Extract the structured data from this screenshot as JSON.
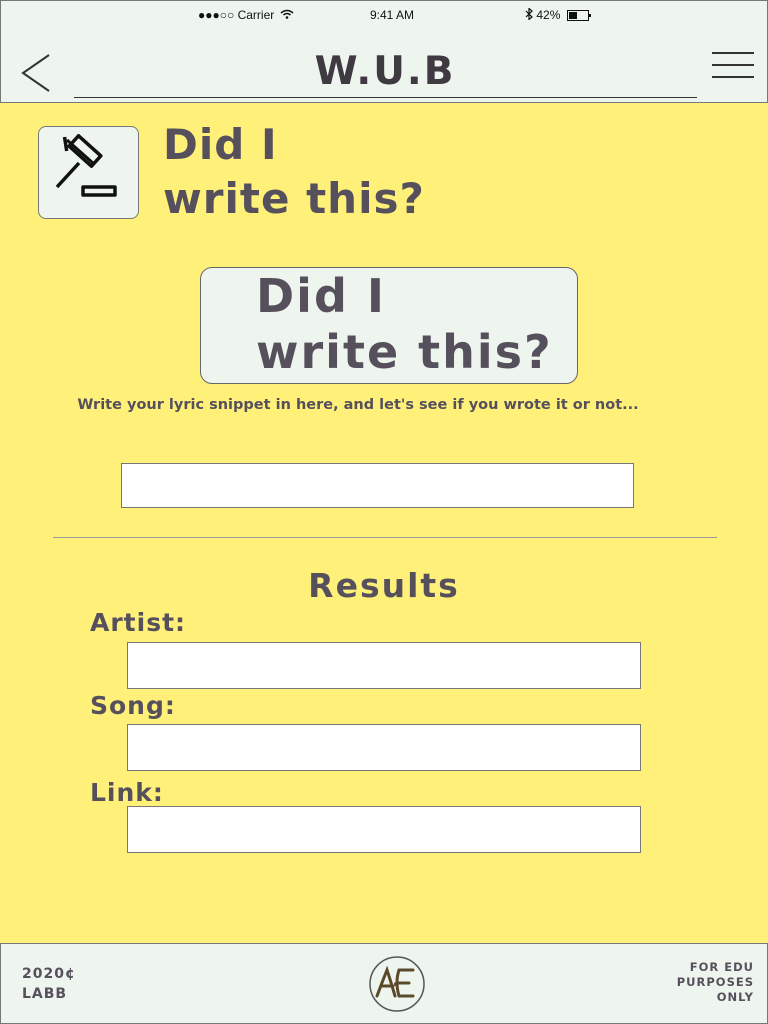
{
  "status_bar": {
    "carrier": "●●●○○ Carrier",
    "wifi_icon": "wifi-icon",
    "time": "9:41 AM",
    "bluetooth_icon": "bluetooth-icon",
    "battery": "42%"
  },
  "header": {
    "title": "W.U.B",
    "back_icon": "chevron-left-icon",
    "menu_icon": "hamburger-menu-icon"
  },
  "page": {
    "icon": "gavel-icon",
    "title_line1": "Did I",
    "title_line2": "write this?"
  },
  "hero": {
    "line1": "Did I",
    "line2": "write this?"
  },
  "instructions": "Write your lyric snippet in here, and let's see if you wrote it or not...",
  "lyric_input": {
    "value": "",
    "placeholder": ""
  },
  "results": {
    "title": "Results",
    "fields": [
      {
        "label": "Artist:",
        "value": ""
      },
      {
        "label": "Song:",
        "value": ""
      },
      {
        "label": "Link:",
        "value": ""
      }
    ]
  },
  "footer": {
    "copyright_line1": "2020¢",
    "copyright_line2": "LABB",
    "logo": "labb-logo",
    "edu_line1": "FOR EDU",
    "edu_line2": "PURPOSES",
    "edu_line3": "ONLY"
  },
  "colors": {
    "background": "#fff07a",
    "panel": "#eef5ee",
    "text": "#56505c"
  }
}
